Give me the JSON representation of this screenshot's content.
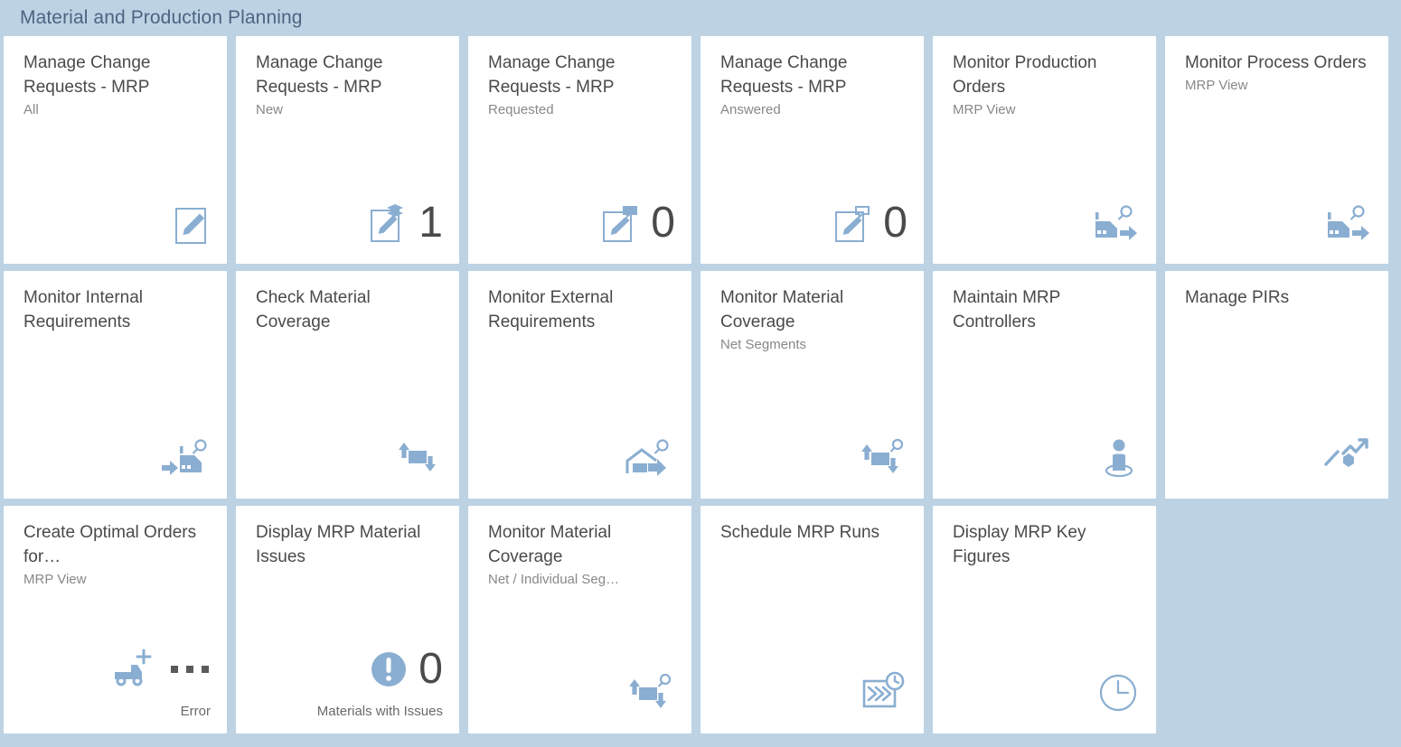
{
  "group": {
    "title": "Material and Production Planning"
  },
  "tiles": [
    {
      "title": "Manage Change Requests - MRP",
      "subtitle": "All",
      "number": "",
      "footer": "",
      "icon": "edit-document-icon"
    },
    {
      "title": "Manage Change Requests - MRP",
      "subtitle": "New",
      "number": "1",
      "footer": "",
      "icon": "edit-document-new-icon"
    },
    {
      "title": "Manage Change Requests - MRP",
      "subtitle": "Requested",
      "number": "0",
      "footer": "",
      "icon": "edit-document-requested-icon"
    },
    {
      "title": "Manage Change Requests - MRP",
      "subtitle": "Answered",
      "number": "0",
      "footer": "",
      "icon": "edit-document-answered-icon"
    },
    {
      "title": "Monitor Production Orders",
      "subtitle": "MRP View",
      "number": "",
      "footer": "",
      "icon": "factory-search-out-icon"
    },
    {
      "title": "Monitor Process Orders",
      "subtitle": "MRP View",
      "number": "",
      "footer": "",
      "icon": "factory-search-out-icon"
    },
    {
      "title": "Monitor Internal Requirements",
      "subtitle": "",
      "number": "",
      "footer": "",
      "icon": "factory-search-in-icon"
    },
    {
      "title": "Check Material Coverage",
      "subtitle": "",
      "number": "",
      "footer": "",
      "icon": "material-coverage-icon"
    },
    {
      "title": "Monitor External Requirements",
      "subtitle": "",
      "number": "",
      "footer": "",
      "icon": "warehouse-search-out-icon"
    },
    {
      "title": "Monitor Material Coverage",
      "subtitle": "Net Segments",
      "number": "",
      "footer": "",
      "icon": "material-coverage-search-icon"
    },
    {
      "title": "Maintain MRP Controllers",
      "subtitle": "",
      "number": "",
      "footer": "",
      "icon": "person-placeholder-icon"
    },
    {
      "title": "Manage PIRs",
      "subtitle": "",
      "number": "",
      "footer": "",
      "icon": "forecast-trend-icon"
    },
    {
      "title": "Create Optimal Orders for…",
      "subtitle": "MRP View",
      "number": "",
      "footer": "Error",
      "icon": "truck-plus-icon",
      "loading_dots": true
    },
    {
      "title": "Display MRP Material Issues",
      "subtitle": "",
      "number": "0",
      "footer": "Materials with Issues",
      "icon": "alert-circle-icon"
    },
    {
      "title": "Monitor Material Coverage",
      "subtitle": "Net / Individual Seg…",
      "number": "",
      "footer": "",
      "icon": "material-coverage-search-icon"
    },
    {
      "title": "Schedule MRP Runs",
      "subtitle": "",
      "number": "",
      "footer": "",
      "icon": "schedule-batch-icon"
    },
    {
      "title": "Display MRP Key Figures",
      "subtitle": "",
      "number": "",
      "footer": "",
      "icon": "clock-icon"
    },
    {
      "title": "",
      "subtitle": "",
      "number": "",
      "footer": "",
      "icon": "",
      "empty": true
    }
  ],
  "colors": {
    "background": "#bdd3e4",
    "tile_background": "#ffffff",
    "icon_blue": "#8aaed1",
    "title_text": "#4a4a4a",
    "subtitle_text": "#888888",
    "group_title_text": "#4c6480"
  }
}
